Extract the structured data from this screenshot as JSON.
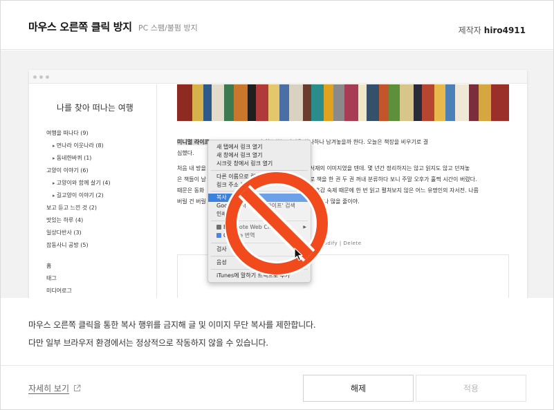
{
  "header": {
    "title": "마우스 오른쪽 클릭 방지",
    "subtitle": "PC 스팸/불펌 방지",
    "author_label": "제작자",
    "author_name": "hiro4911"
  },
  "preview": {
    "blog_title": "나를 찾아 떠나는 여행",
    "categories": [
      "여행을 떠나다 (9)",
      "먼나라 이웃나라 (8)",
      "동네한바퀴 (1)",
      "고양이 이야기 (6)",
      "고양이와 함께 살기 (4)",
      "길고양이 이야기 (2)",
      "보고 듣고 느낀 것 (2)",
      "맛있는 하루 (4)",
      "일상다반사 (3)",
      "잡동사니 공방 (5)"
    ],
    "nav_links": [
      "홈",
      "태그",
      "미디어로그"
    ],
    "post_highlight": "미니멀 라이프",
    "post_line1_tail": "고자 청소하는 과정을 하나하나 남겨놓을까 한다. 오늘은 책장을 비우기로 결",
    "post_line2": "심했다.",
    "post_para2_line1_a": "처음 내 방을",
    "post_para2_line1_b": "인 오",
    "post_para2_line1_c": "서재의 이미지였을 텐데. 몇 년간 정리하지는 않고 읽지도 않고 던져놓",
    "post_para2_line2_a": "은 책들이 날",
    "post_para2_line2_b": "로 책을 한 권 두 권 꺼내 분류하다 보니 주말 오후가 훌쩍 시간이 버렸다.",
    "post_para2_line3_a": "때문은 동화",
    "post_para2_line3_b": "후감 숙제 때문에 한 번 읽고 펼쳐보지 않은 어느 유명인의 자서전. 나름",
    "post_para2_line4_a": "버릴 건 버릴",
    "post_para2_line4_b": "나 많을 줄이야.",
    "post_actions": "Modify  |  Delete"
  },
  "context_menu": {
    "items": [
      "새 탭에서 링크 열기",
      "새 창에서 링크 열기",
      "시크릿 창에서 링크 열기",
      "다른 이름으로 링크 저장...",
      "링크 주소 복사",
      "복사",
      "Google에서 '미니멀 라이프' 검색",
      "인쇄",
      "Evernote Web Clipper",
      "Google 번역",
      "검사",
      "음성",
      "iTunes에 말하기 트랙으로 추가"
    ]
  },
  "description": {
    "line1": "마우스 오른쪽 클릭을 통한 복사 행위를 금지해 글 및 이미지 무단 복사를 제한합니다.",
    "line2": "다만 일부 브라우저 환경에서는 정상적으로 작동하지 않을 수 있습니다."
  },
  "footer": {
    "more_link": "자세히 보기",
    "release_button": "해제",
    "apply_button": "적용"
  },
  "colors": {
    "no_sign": "#f04a1d",
    "menu_highlight": "#3b82e0",
    "apply_disabled_text": "#b8b8b8"
  },
  "icons": {
    "external_link": "external-link-icon",
    "cursor": "mouse-pointer-icon",
    "prohibition": "prohibition-icon"
  }
}
